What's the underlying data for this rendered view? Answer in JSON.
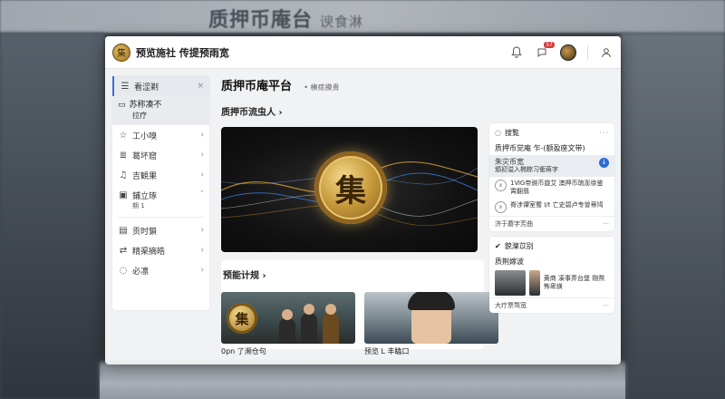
{
  "background": {
    "title": "质押币庵台",
    "title_suffix": "谀食淋"
  },
  "topbar": {
    "app_name": "预览施社 传提预雨宽",
    "notification_badge": "57",
    "icons": [
      "bell-icon",
      "chat-icon",
      "avatar",
      "user-icon"
    ]
  },
  "sidebar": {
    "active_item": {
      "label": "看涩剃",
      "close": "×"
    },
    "sub_item": {
      "title": "苏称凑不",
      "caption": "拉疗"
    },
    "items": [
      {
        "label": "工小嗅",
        "icon": "star-icon"
      },
      {
        "label": "葛坏窟",
        "icon": "list-icon"
      },
      {
        "label": "吉観果",
        "icon": "music-icon"
      },
      {
        "label": "鋪立琢",
        "sub": "期 1",
        "icon": "book-icon"
      },
      {
        "label": "贡时鎖",
        "icon": "calendar-icon"
      },
      {
        "label": "精渠摘皓",
        "icon": "swap-icon"
      },
      {
        "label": "必凛",
        "icon": "chat-bubble-icon"
      }
    ]
  },
  "main": {
    "page_title": "质押币庵平台",
    "page_tag": "楱痣摸贵",
    "hero_section": "质押币流虫人",
    "hero_glyph": "集",
    "section2": "预能计规",
    "cards": [
      {
        "label": "0pn 了濒仓句",
        "glyph": "集"
      },
      {
        "label": "预览 L 丰瞌口"
      }
    ]
  },
  "right_panel": {
    "panel1": {
      "title": "搜覧",
      "more": "···",
      "headline": "质押币觉庵 乍-(额盈座文带)",
      "row1_title": "朱灾币宽",
      "row1_text": "頒初溢入椭粽习衝蒋字",
      "row2": "1ⅥG帝豌币旋艾 澳押币琉澎徐鉴霄翻翡",
      "row3": "脊涉谭室蜀 I/t 亡史碧卢专曽蒂鸠",
      "footer": "济于蘑字芳曲",
      "footer_more": "···"
    },
    "panel2": {
      "title": "貌濼苡别",
      "sub": "质荆嫁波",
      "thumb_caption": "黄商 凑事弄台堡 剛熬怖卑熿",
      "footer": "大疗票骛宽",
      "footer_more": "···"
    }
  }
}
